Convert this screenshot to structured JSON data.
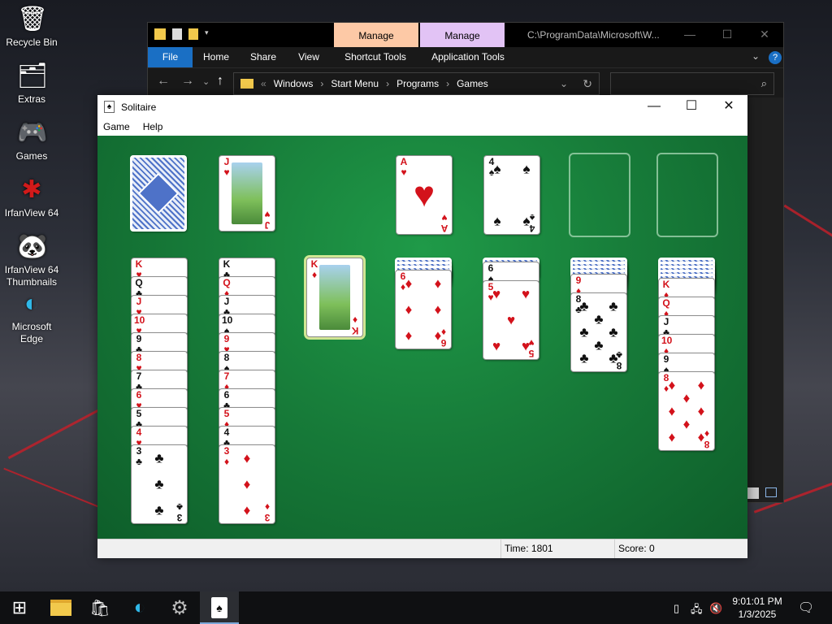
{
  "desktop": {
    "icons": [
      {
        "label": "Recycle Bin",
        "icon": "recycle-bin-icon"
      },
      {
        "label": "Extras",
        "icon": "folder-icon"
      },
      {
        "label": "Games",
        "icon": "gamepad-icon"
      },
      {
        "label": "IrfanView 64",
        "icon": "irfanview-icon"
      },
      {
        "label": "IrfanView 64 Thumbnails",
        "icon": "irfanview-thumbnails-icon"
      },
      {
        "label": "Microsoft Edge",
        "icon": "edge-icon"
      }
    ]
  },
  "explorer": {
    "manage_tab_1": "Manage",
    "manage_tab_2": "Manage",
    "path_title": "C:\\ProgramData\\Microsoft\\W...",
    "ribbon_tabs": [
      "File",
      "Home",
      "Share",
      "View",
      "Shortcut Tools",
      "Application Tools"
    ],
    "breadcrumb": [
      "Windows",
      "Start Menu",
      "Programs",
      "Games"
    ],
    "colors": {
      "manage_1": "#fdc9a6",
      "manage_2": "#e2c3f5",
      "file_tab": "#1a6fc4"
    }
  },
  "solitaire": {
    "title": "Solitaire",
    "menu": [
      "Game",
      "Help"
    ],
    "status": {
      "time": "Time: 1801",
      "score": "Score: 0"
    },
    "felt_color": "#177b39",
    "stock": "face-down",
    "waste": {
      "rank": "J",
      "suit": "♥",
      "color": "red"
    },
    "foundations": [
      {
        "rank": "A",
        "suit": "♥",
        "color": "red"
      },
      {
        "rank": "4",
        "suit": "♠",
        "color": "black"
      },
      {
        "empty": true
      },
      {
        "empty": true
      }
    ],
    "tableau": [
      {
        "hidden": 0,
        "cards": [
          [
            "K",
            "♥"
          ],
          [
            "Q",
            "♣"
          ],
          [
            "J",
            "♥"
          ],
          [
            "10",
            "♥"
          ],
          [
            "9",
            "♣"
          ],
          [
            "8",
            "♥"
          ],
          [
            "7",
            "♣"
          ],
          [
            "6",
            "♥"
          ],
          [
            "5",
            "♣"
          ],
          [
            "4",
            "♥"
          ],
          [
            "3",
            "♣"
          ]
        ]
      },
      {
        "hidden": 0,
        "cards": [
          [
            "K",
            "♣"
          ],
          [
            "Q",
            "♦"
          ],
          [
            "J",
            "♣"
          ],
          [
            "10",
            "♠"
          ],
          [
            "9",
            "♥"
          ],
          [
            "8",
            "♠"
          ],
          [
            "7",
            "♦"
          ],
          [
            "6",
            "♣"
          ],
          [
            "5",
            "♦"
          ],
          [
            "4",
            "♣"
          ],
          [
            "3",
            "♦"
          ]
        ]
      },
      {
        "hidden": 0,
        "cards": [
          [
            "K",
            "♦"
          ]
        ]
      },
      {
        "hidden": 3,
        "cards": [
          [
            "6",
            "♦"
          ]
        ]
      },
      {
        "hidden": 1,
        "cards": [
          [
            "6",
            "♠"
          ],
          [
            "5",
            "♥"
          ]
        ]
      },
      {
        "hidden": 4,
        "cards": [
          [
            "9",
            "♦"
          ],
          [
            "8",
            "♣"
          ]
        ]
      },
      {
        "hidden": 5,
        "cards": [
          [
            "K",
            "♦"
          ],
          [
            "Q",
            "♦"
          ],
          [
            "J",
            "♣"
          ],
          [
            "10",
            "♦"
          ],
          [
            "9",
            "♠"
          ],
          [
            "8",
            "♦"
          ]
        ]
      }
    ]
  },
  "taskbar": {
    "items": [
      "start-icon",
      "file-explorer-icon",
      "store-icon",
      "edge-icon",
      "settings-gear-icon",
      "solitaire-icon"
    ],
    "clock_time": "9:01:01 PM",
    "clock_date": "1/3/2025"
  }
}
